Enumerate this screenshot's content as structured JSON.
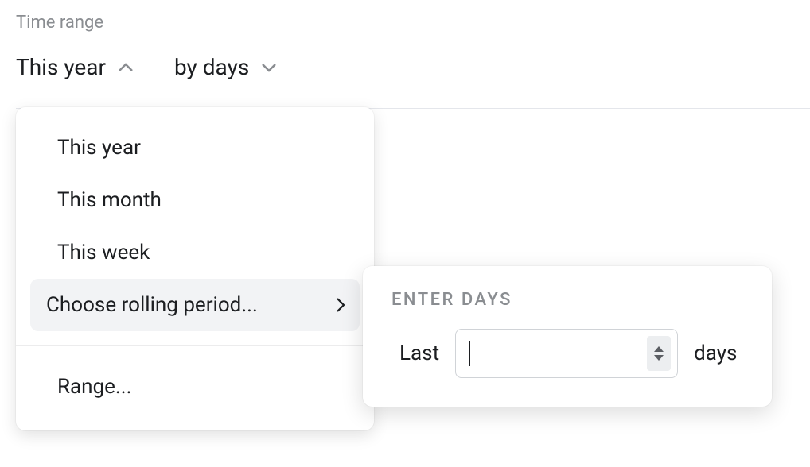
{
  "header": {
    "label": "Time range"
  },
  "selectors": {
    "range": "This year",
    "granularity": "by days"
  },
  "menu": {
    "items": [
      "This year",
      "This month",
      "This week",
      "Choose rolling period..."
    ],
    "footer": "Range..."
  },
  "submenu": {
    "title": "Enter days",
    "prefix": "Last",
    "suffix": "days",
    "value": ""
  }
}
